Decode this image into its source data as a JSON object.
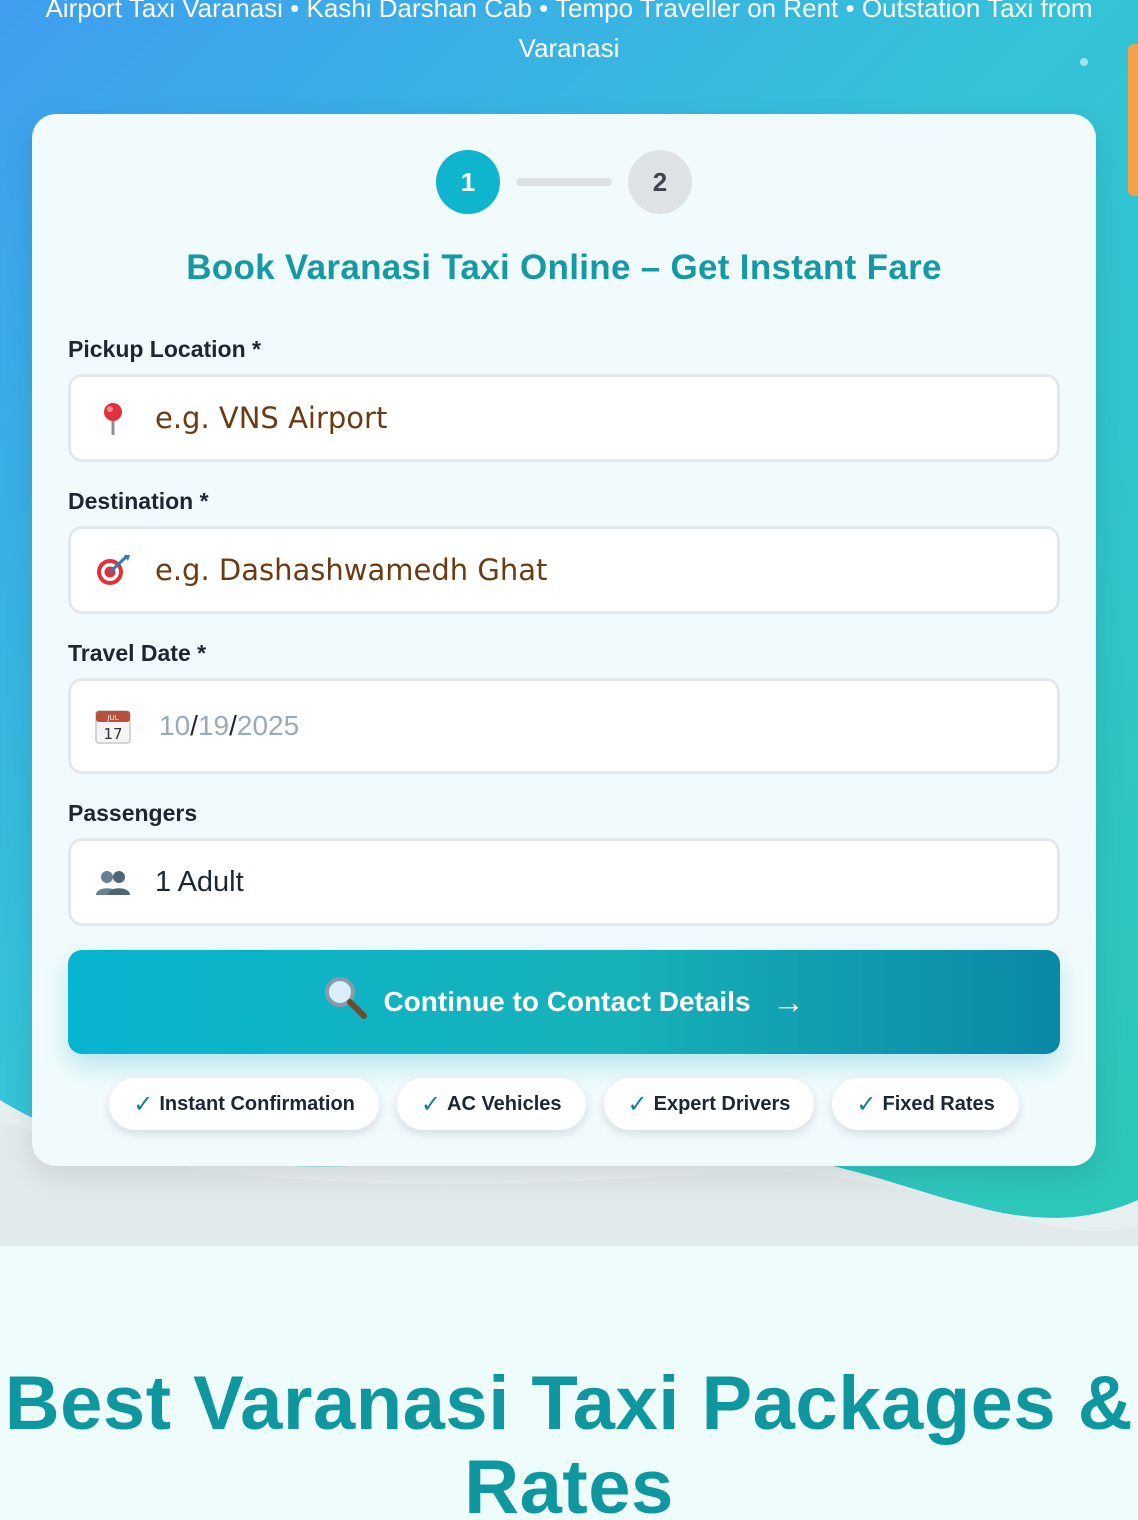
{
  "hero": {
    "tagline": "Airport Taxi Varanasi • Kashi Darshan Cab • Tempo Traveller on Rent • Outstation Taxi from Varanasi"
  },
  "booking_form": {
    "steps": [
      "1",
      "2"
    ],
    "title": "Book Varanasi Taxi Online – Get Instant Fare",
    "pickup": {
      "label": "Pickup Location *",
      "placeholder": "e.g. VNS Airport",
      "icon": "round-pushpin-icon"
    },
    "destination": {
      "label": "Destination *",
      "placeholder": "e.g. Dashashwamedh Ghat",
      "icon": "target-icon"
    },
    "travel_date": {
      "label": "Travel Date *",
      "month": "10",
      "day": "19",
      "year": "2025",
      "separator": "/",
      "icon": "calendar-icon",
      "calendar_month": "JUL",
      "calendar_day": "17"
    },
    "passengers": {
      "label": "Passengers",
      "value": "1 Adult",
      "icon": "two-people-icon"
    },
    "submit": {
      "label": "Continue to Contact Details",
      "icon": "magnifier-icon",
      "arrow": "→"
    },
    "badges": [
      {
        "check": "✓",
        "text": "Instant Confirmation"
      },
      {
        "check": "✓",
        "text": "AC Vehicles"
      },
      {
        "check": "✓",
        "text": "Expert Drivers"
      },
      {
        "check": "✓",
        "text": "Fixed Rates"
      }
    ],
    "colors": {
      "accent": "#0fb4cf",
      "title": "#1599a3",
      "placeholder": "#6b3c14"
    }
  },
  "packages": {
    "title": "Best Varanasi Taxi Packages & Rates"
  }
}
